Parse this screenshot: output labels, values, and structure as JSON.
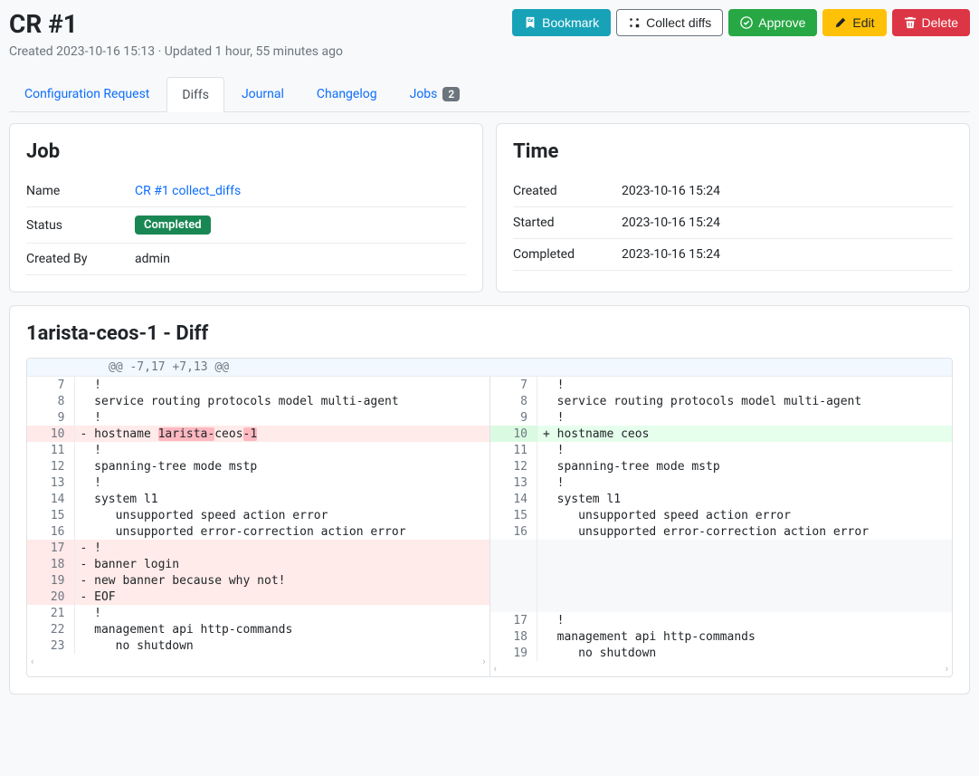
{
  "header": {
    "title": "CR #1",
    "subtitle": "Created 2023-10-16 15:13 · Updated 1 hour, 55 minutes ago"
  },
  "actions": {
    "bookmark": "Bookmark",
    "collect": "Collect diffs",
    "approve": "Approve",
    "edit": "Edit",
    "delete": "Delete"
  },
  "tabs": {
    "config_request": "Configuration Request",
    "diffs": "Diffs",
    "journal": "Journal",
    "changelog": "Changelog",
    "jobs": "Jobs",
    "jobs_count": "2"
  },
  "job_card": {
    "title": "Job",
    "name_label": "Name",
    "name_value": "CR #1 collect_diffs",
    "status_label": "Status",
    "status_value": "Completed",
    "created_by_label": "Created By",
    "created_by_value": "admin"
  },
  "time_card": {
    "title": "Time",
    "created_label": "Created",
    "created_value": "2023-10-16 15:24",
    "started_label": "Started",
    "started_value": "2023-10-16 15:24",
    "completed_label": "Completed",
    "completed_value": "2023-10-16 15:24"
  },
  "diff": {
    "title": "1arista-ceos-1 - Diff",
    "hunk": "@@ -7,17 +7,13 @@",
    "left": [
      {
        "ln": "7",
        "type": "ctx",
        "text": "  !"
      },
      {
        "ln": "8",
        "type": "ctx",
        "text": "  service routing protocols model multi-agent"
      },
      {
        "ln": "9",
        "type": "ctx",
        "text": "  !"
      },
      {
        "ln": "10",
        "type": "del",
        "prefix": "- hostname ",
        "hl1": "1arista-",
        "mid": "ceos",
        "hl2": "-1"
      },
      {
        "ln": "11",
        "type": "ctx",
        "text": "  !"
      },
      {
        "ln": "12",
        "type": "ctx",
        "text": "  spanning-tree mode mstp"
      },
      {
        "ln": "13",
        "type": "ctx",
        "text": "  !"
      },
      {
        "ln": "14",
        "type": "ctx",
        "text": "  system l1"
      },
      {
        "ln": "15",
        "type": "ctx",
        "text": "     unsupported speed action error"
      },
      {
        "ln": "16",
        "type": "ctx",
        "text": "     unsupported error-correction action error"
      },
      {
        "ln": "17",
        "type": "del",
        "text": "- !"
      },
      {
        "ln": "18",
        "type": "del",
        "text": "- banner login"
      },
      {
        "ln": "19",
        "type": "del",
        "text": "- new banner because why not!"
      },
      {
        "ln": "20",
        "type": "del",
        "text": "- EOF"
      },
      {
        "ln": "21",
        "type": "ctx",
        "text": "  !"
      },
      {
        "ln": "22",
        "type": "ctx",
        "text": "  management api http-commands"
      },
      {
        "ln": "23",
        "type": "ctx",
        "text": "     no shutdown"
      }
    ],
    "right": [
      {
        "ln": "7",
        "type": "ctx",
        "text": "  !"
      },
      {
        "ln": "8",
        "type": "ctx",
        "text": "  service routing protocols model multi-agent"
      },
      {
        "ln": "9",
        "type": "ctx",
        "text": "  !"
      },
      {
        "ln": "10",
        "type": "add",
        "text": "+ hostname ceos"
      },
      {
        "ln": "11",
        "type": "ctx",
        "text": "  !"
      },
      {
        "ln": "12",
        "type": "ctx",
        "text": "  spanning-tree mode mstp"
      },
      {
        "ln": "13",
        "type": "ctx",
        "text": "  !"
      },
      {
        "ln": "14",
        "type": "ctx",
        "text": "  system l1"
      },
      {
        "ln": "15",
        "type": "ctx",
        "text": "     unsupported speed action error"
      },
      {
        "ln": "16",
        "type": "ctx",
        "text": "     unsupported error-correction action error"
      },
      {
        "ln": "",
        "type": "empty",
        "text": ""
      },
      {
        "ln": "",
        "type": "empty",
        "text": ""
      },
      {
        "ln": "",
        "type": "empty",
        "text": ""
      },
      {
        "ln": "",
        "type": "empty",
        "text": ""
      },
      {
        "ln": "17",
        "type": "ctx",
        "text": "  !"
      },
      {
        "ln": "18",
        "type": "ctx",
        "text": "  management api http-commands"
      },
      {
        "ln": "19",
        "type": "ctx",
        "text": "     no shutdown"
      }
    ]
  }
}
